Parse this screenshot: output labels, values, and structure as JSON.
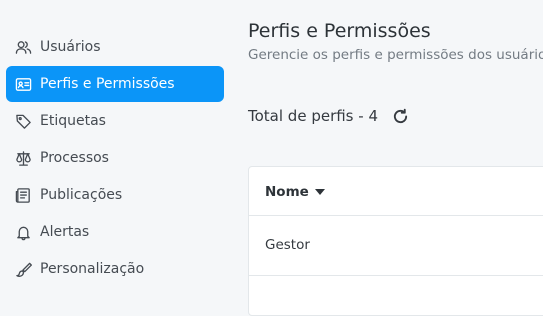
{
  "sidebar": {
    "items": [
      {
        "label": "Usuários",
        "icon": "users-icon"
      },
      {
        "label": "Perfis e Permissões",
        "icon": "id-card-icon",
        "active": true
      },
      {
        "label": "Etiquetas",
        "icon": "tag-icon"
      },
      {
        "label": "Processos",
        "icon": "scale-icon"
      },
      {
        "label": "Publicações",
        "icon": "newspaper-icon"
      },
      {
        "label": "Alertas",
        "icon": "bell-icon"
      },
      {
        "label": "Personalização",
        "icon": "brush-icon"
      }
    ]
  },
  "main": {
    "title": "Perfis e Permissões",
    "subtitle": "Gerencie os perfis e permissões dos usuários",
    "total_label": "Total de perfis - 4",
    "refresh_icon": "refresh-icon",
    "table": {
      "columns": [
        {
          "label": "Nome",
          "sort": "desc"
        }
      ],
      "rows": [
        {
          "nome": "Gestor"
        }
      ]
    }
  },
  "colors": {
    "accent": "#0b95f8",
    "background": "#f5f7f9",
    "card": "#ffffff"
  }
}
